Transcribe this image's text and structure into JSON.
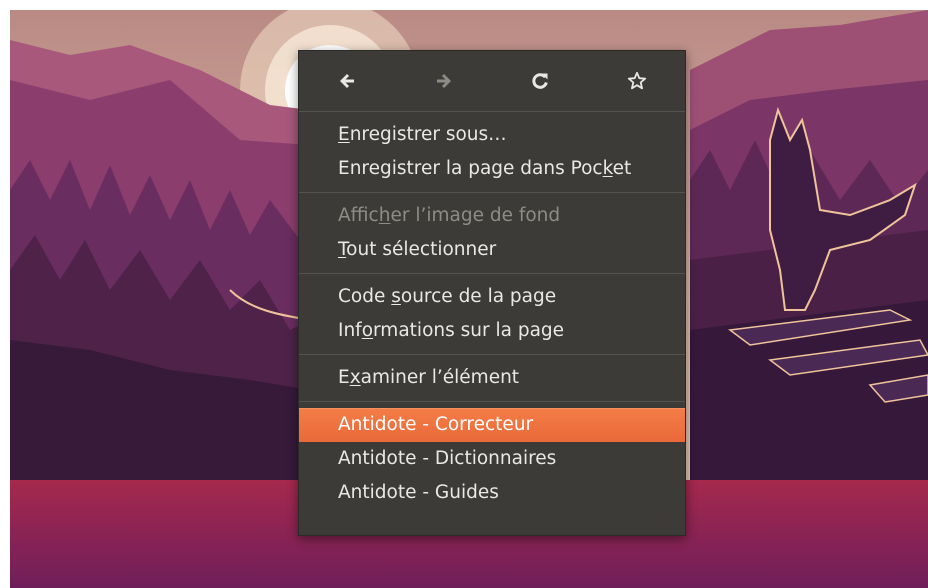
{
  "colors": {
    "menu_background": "#3c3b37",
    "menu_text": "#e8e8e6",
    "disabled_text": "#8e8c85",
    "highlight": "#f07a44",
    "separator": "#55534d"
  },
  "navigation": [
    {
      "icon": "arrow-left-icon",
      "enabled": true
    },
    {
      "icon": "arrow-right-icon",
      "enabled": false
    },
    {
      "icon": "reload-icon",
      "enabled": true
    },
    {
      "icon": "star-outline-icon",
      "enabled": true
    }
  ],
  "menu": {
    "groups": [
      [
        {
          "label": "Enregistrer sous…",
          "mnemonic": "E",
          "disabled": false
        },
        {
          "label": "Enregistrer la page dans Pocket",
          "mnemonic": "k",
          "disabled": false
        }
      ],
      [
        {
          "label": "Afficher l’image de fond",
          "mnemonic": "h",
          "disabled": true
        },
        {
          "label": "Tout sélectionner",
          "mnemonic": "T",
          "disabled": false
        }
      ],
      [
        {
          "label": "Code source de la page",
          "mnemonic": "s",
          "disabled": false
        },
        {
          "label": "Informations sur la page",
          "mnemonic": "o",
          "disabled": false
        }
      ],
      [
        {
          "label": "Examiner l’élément",
          "mnemonic": "x",
          "disabled": false
        }
      ],
      [
        {
          "label": "Antidote - Correcteur",
          "mnemonic": "",
          "disabled": false,
          "active": true
        },
        {
          "label": "Antidote - Dictionnaires",
          "mnemonic": "",
          "disabled": false
        },
        {
          "label": "Antidote - Guides",
          "mnemonic": "",
          "disabled": false
        }
      ]
    ]
  }
}
